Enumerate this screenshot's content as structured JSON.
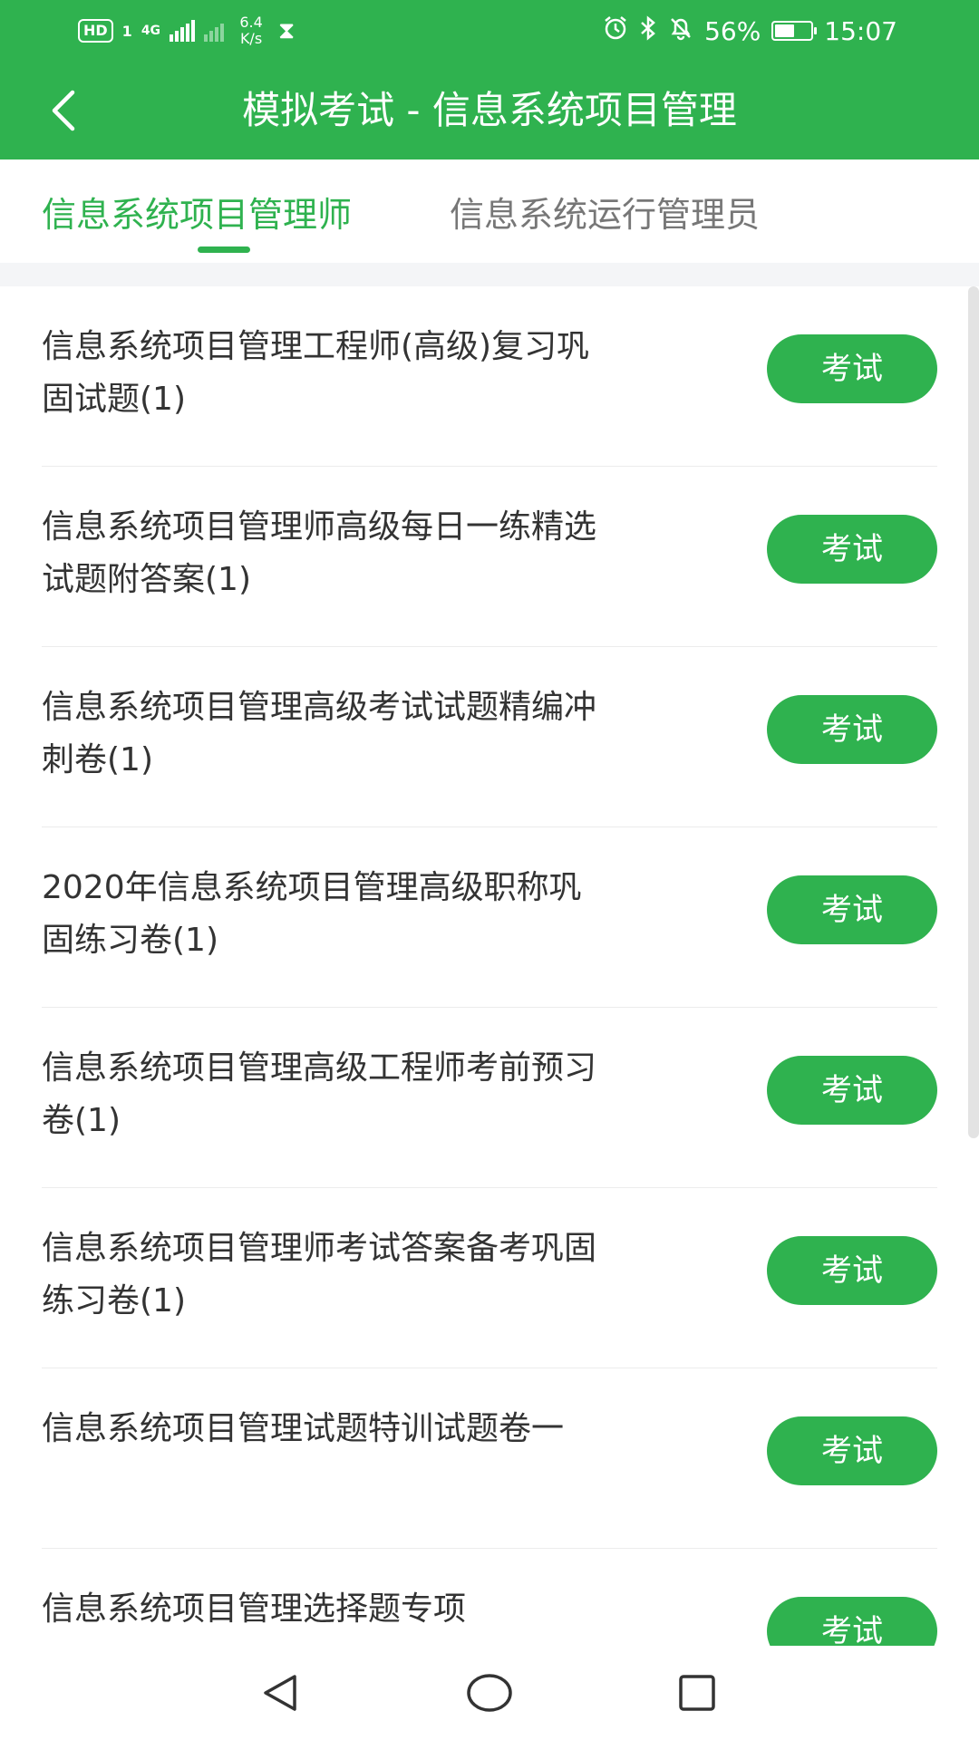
{
  "status_bar": {
    "hd": "HD",
    "sim_slot": "1",
    "network_type": "4G",
    "speed_value": "6.4",
    "speed_unit": "K/s",
    "battery_percent": "56%",
    "battery_level": 0.56,
    "time": "15:07"
  },
  "header": {
    "title": "模拟考试 - 信息系统项目管理",
    "background_color": "#2fb24f"
  },
  "tabs": [
    {
      "label": "信息系统项目管理师",
      "active": true
    },
    {
      "label": "信息系统运行管理员",
      "active": false
    }
  ],
  "exam_list": [
    {
      "title": "信息系统项目管理工程师(高级)复习巩固试题(1)",
      "button": "考试"
    },
    {
      "title": "信息系统项目管理师高级每日一练精选试题附答案(1)",
      "button": "考试"
    },
    {
      "title": "信息系统项目管理高级考试试题精编冲刺卷(1)",
      "button": "考试"
    },
    {
      "title": "2020年信息系统项目管理高级职称巩固练习卷(1)",
      "button": "考试"
    },
    {
      "title": "信息系统项目管理高级工程师考前预习卷(1)",
      "button": "考试"
    },
    {
      "title": "信息系统项目管理师考试答案备考巩固练习卷(1)",
      "button": "考试"
    },
    {
      "title": "信息系统项目管理试题特训试题卷一",
      "button": "考试"
    },
    {
      "title": "信息系统项目管理选择题专项",
      "button": "考试"
    }
  ],
  "icons": {
    "back": "chevron-left-icon",
    "nav_back": "triangle-back-icon",
    "nav_home": "circle-home-icon",
    "nav_recent": "square-recent-icon"
  }
}
